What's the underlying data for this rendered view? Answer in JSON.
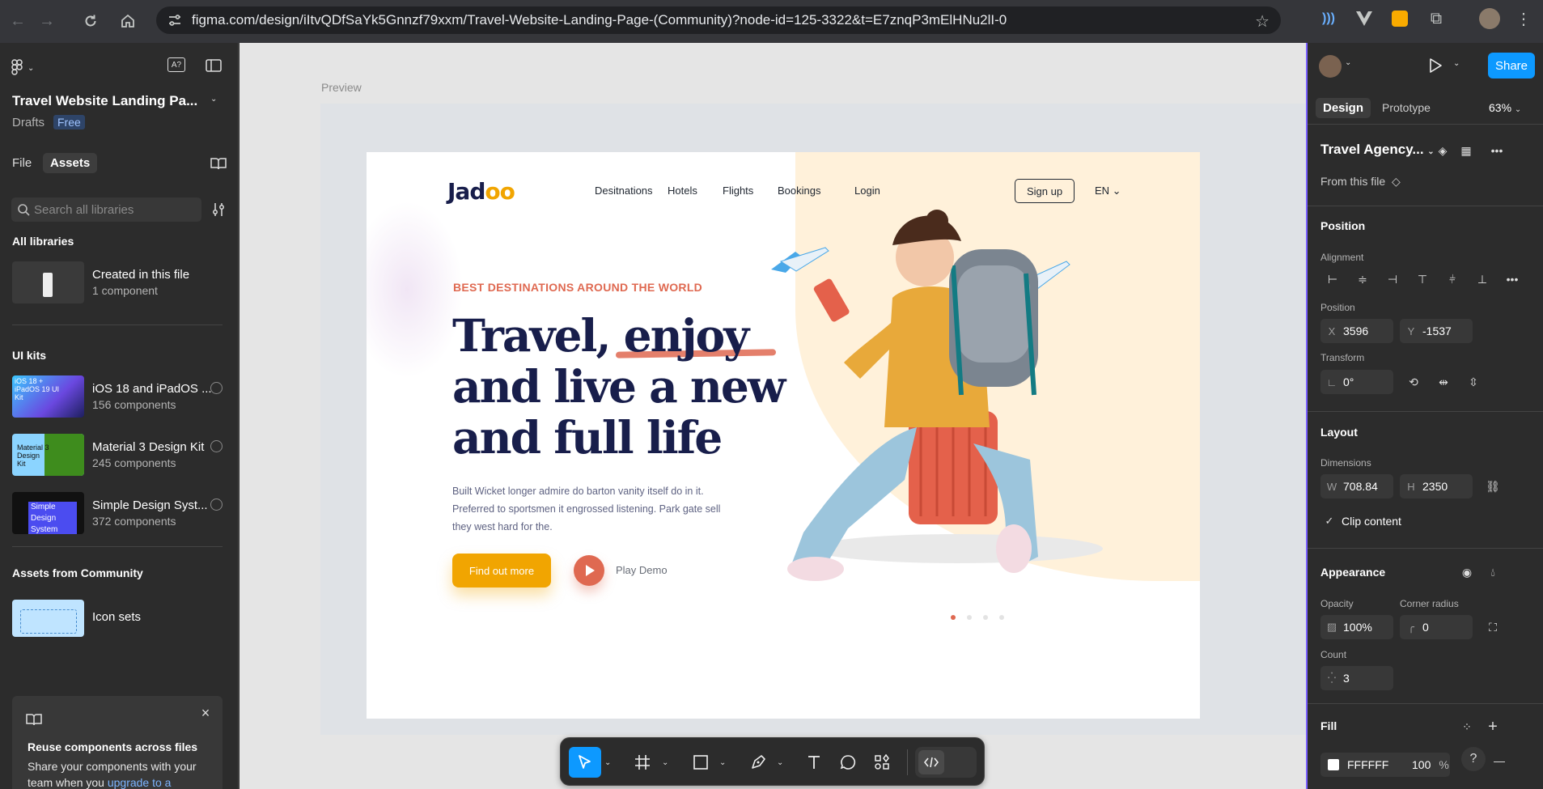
{
  "browser": {
    "url": "figma.com/design/iItvQDfSaYk5Gnnzf79xxm/Travel-Website-Landing-Page-(Community)?node-id=125-3322&t=E7znqP3mElHNu2lI-0"
  },
  "left_panel": {
    "file_title": "Travel Website Landing Pa...",
    "drafts": "Drafts",
    "plan_badge": "Free",
    "tabs": [
      "File",
      "Assets"
    ],
    "search_placeholder": "Search all libraries",
    "all_libraries": "All libraries",
    "created_in_file": {
      "name": "Created in this file",
      "count": "1 component"
    },
    "ui_kits_heading": "UI kits",
    "ui_kits": [
      {
        "name": "iOS 18 and iPadOS ...",
        "count": "156 components",
        "thumb_text": "iOS 18 + iPadOS 19 UI Kit"
      },
      {
        "name": "Material 3 Design Kit",
        "count": "245 components",
        "thumb_text": "Material 3 Design Kit"
      },
      {
        "name": "Simple Design Syst...",
        "count": "372 components",
        "thumb_text": "Simple Design System"
      }
    ],
    "community_heading": "Assets from Community",
    "community_item": "Icon sets",
    "promo": {
      "title": "Reuse components across files",
      "body": "Share your components with your team when you ",
      "link": "upgrade to a Professional plan",
      "tail": "."
    }
  },
  "canvas": {
    "preview_label": "Preview",
    "site": {
      "logo": "Jad",
      "logo_oo": "oo",
      "nav": [
        "Desitnations",
        "Hotels",
        "Flights",
        "Bookings"
      ],
      "login": "Login",
      "signup": "Sign up",
      "lang": "EN",
      "eyebrow": "BEST DESTINATIONS AROUND THE WORLD",
      "headline_1": "Travel, enjoy",
      "headline_2": "and live a new",
      "headline_3": "and full life",
      "paragraph": "Built Wicket longer admire do barton vanity itself do in it. Preferred to sportsmen it engrossed listening. Park gate sell they west hard for the.",
      "cta": "Find out more",
      "play_demo": "Play Demo"
    }
  },
  "right_panel": {
    "tabs": [
      "Design",
      "Prototype"
    ],
    "zoom": "63%",
    "share": "Share",
    "component_name": "Travel Agency...",
    "from_file": "From this file",
    "position_heading": "Position",
    "alignment_label": "Alignment",
    "position_label": "Position",
    "x_prefix": "X",
    "x_value": "3596",
    "y_prefix": "Y",
    "y_value": "-1537",
    "transform_label": "Transform",
    "rotation": "0°",
    "layout_heading": "Layout",
    "dimensions_label": "Dimensions",
    "w_prefix": "W",
    "w_value": "708.84",
    "h_prefix": "H",
    "h_value": "2350",
    "clip_content": "Clip content",
    "appearance_heading": "Appearance",
    "opacity_label": "Opacity",
    "opacity_value": "100%",
    "corner_label": "Corner radius",
    "corner_value": "0",
    "count_label": "Count",
    "count_value": "3",
    "fill_heading": "Fill",
    "fill_hex": "FFFFFF",
    "fill_opacity": "100",
    "fill_pct": "%"
  },
  "colors": {
    "accent": "#0d99ff",
    "selection": "#7b61ff",
    "site_orange": "#f1a501",
    "site_coral": "#df6951",
    "site_navy": "#181e4b"
  }
}
